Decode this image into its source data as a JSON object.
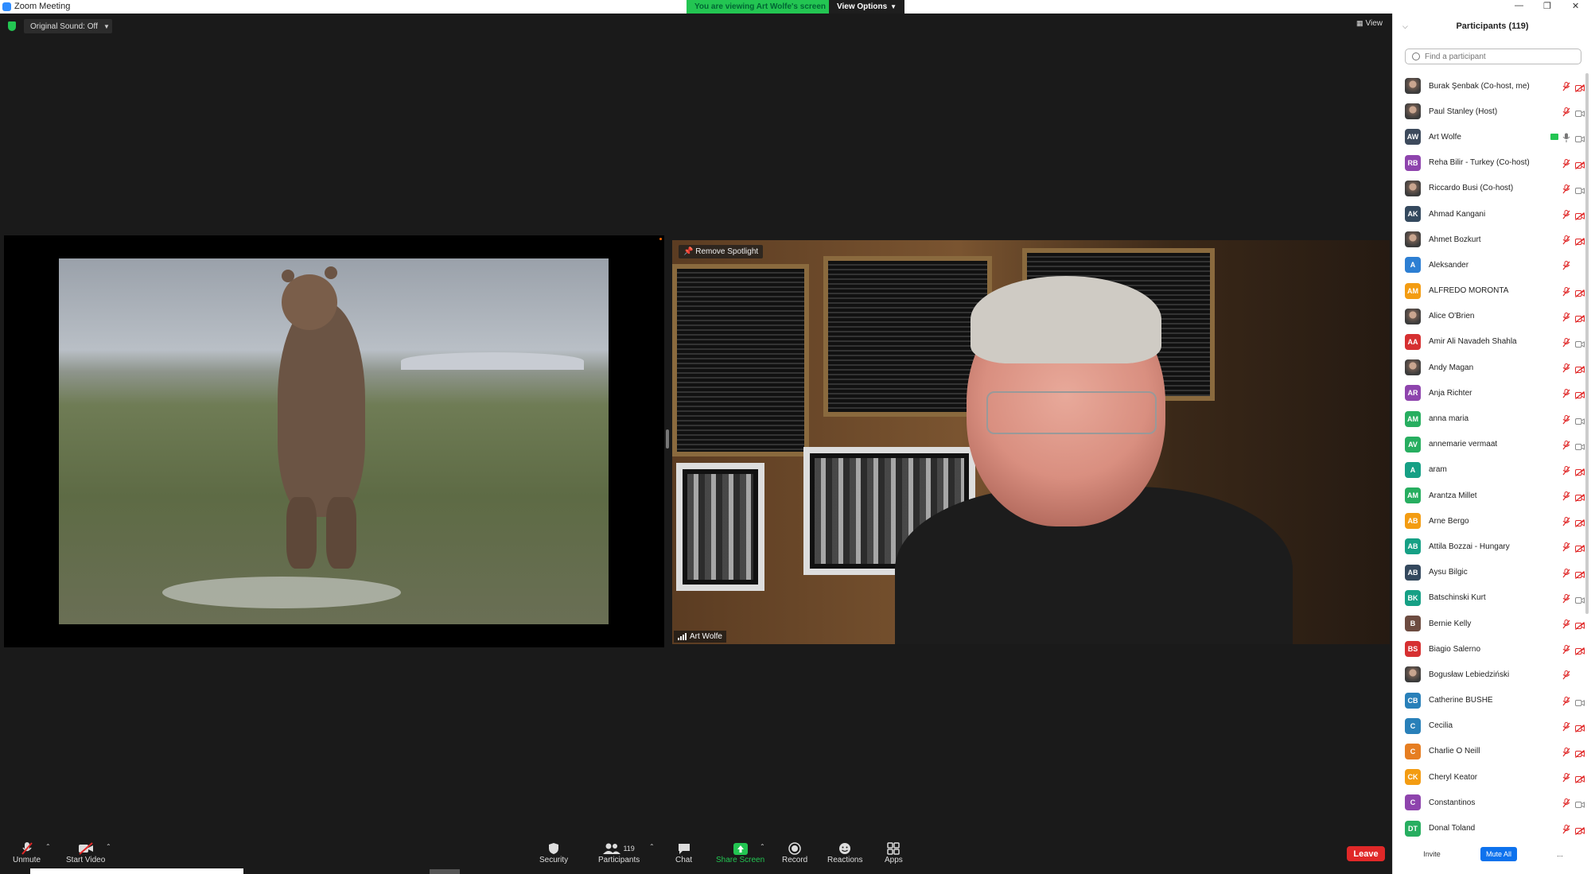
{
  "window": {
    "title": "Zoom Meeting"
  },
  "banner": {
    "viewing_text": "You are viewing Art Wolfe's screen",
    "view_options_label": "View Options"
  },
  "top_left": {
    "original_sound_label": "Original Sound: Off"
  },
  "top_right": {
    "view_label": "View"
  },
  "video": {
    "remove_spotlight_label": "Remove Spotlight",
    "speaker_name": "Art Wolfe"
  },
  "toolbar": {
    "unmute_label": "Unmute",
    "start_video_label": "Start Video",
    "security_label": "Security",
    "participants_label": "Participants",
    "participants_count": "119",
    "chat_label": "Chat",
    "share_screen_label": "Share Screen",
    "record_label": "Record",
    "reactions_label": "Reactions",
    "apps_label": "Apps",
    "leave_label": "Leave"
  },
  "panel": {
    "title": "Participants (119)",
    "search_placeholder": "Find a participant",
    "invite_label": "Invite",
    "mute_all_label": "Mute All",
    "more_label": "...",
    "participants": [
      {
        "name": "Burak Şenbak (Co-host, me)",
        "initials": "",
        "photo": true,
        "color": "#444",
        "mic": "off",
        "video": "off"
      },
      {
        "name": "Paul Stanley (Host)",
        "initials": "",
        "photo": true,
        "color": "#888",
        "mic": "off",
        "video": "on"
      },
      {
        "name": "Art Wolfe",
        "initials": "AW",
        "photo": false,
        "color": "#3d4a5c",
        "mic": "on",
        "video": "on",
        "sharing": true
      },
      {
        "name": "Reha Bilir - Turkey (Co-host)",
        "initials": "RB",
        "photo": false,
        "color": "#8e44ad",
        "mic": "off",
        "video": "off"
      },
      {
        "name": "Riccardo Busi (Co-host)",
        "initials": "",
        "photo": true,
        "color": "#aab",
        "mic": "off",
        "video": "on"
      },
      {
        "name": "Ahmad Kangani",
        "initials": "AK",
        "photo": false,
        "color": "#34495e",
        "mic": "off",
        "video": "off"
      },
      {
        "name": "Ahmet Bozkurt",
        "initials": "",
        "photo": true,
        "color": "#777",
        "mic": "off",
        "video": "off"
      },
      {
        "name": "Aleksander",
        "initials": "A",
        "photo": false,
        "color": "#2d7fd3",
        "mic": "off",
        "video": "none"
      },
      {
        "name": "ALFREDO MORONTA",
        "initials": "AM",
        "photo": false,
        "color": "#f39c12",
        "mic": "off",
        "video": "off"
      },
      {
        "name": "Alice O'Brien",
        "initials": "",
        "photo": true,
        "color": "#a77",
        "mic": "off",
        "video": "off"
      },
      {
        "name": "Amir Ali Navadeh Shahla",
        "initials": "AA",
        "photo": false,
        "color": "#d63031",
        "mic": "off",
        "video": "on"
      },
      {
        "name": "Andy Magan",
        "initials": "",
        "photo": true,
        "color": "#665",
        "mic": "off",
        "video": "off"
      },
      {
        "name": "Anja Richter",
        "initials": "AR",
        "photo": false,
        "color": "#8e44ad",
        "mic": "off",
        "video": "off"
      },
      {
        "name": "anna maria",
        "initials": "AM",
        "photo": false,
        "color": "#27ae60",
        "mic": "off",
        "video": "on"
      },
      {
        "name": "annemarie vermaat",
        "initials": "AV",
        "photo": false,
        "color": "#27ae60",
        "mic": "off",
        "video": "on"
      },
      {
        "name": "aram",
        "initials": "A",
        "photo": false,
        "color": "#16a085",
        "mic": "off",
        "video": "off"
      },
      {
        "name": "Arantza Millet",
        "initials": "AM",
        "photo": false,
        "color": "#27ae60",
        "mic": "off",
        "video": "off"
      },
      {
        "name": "Arne Bergo",
        "initials": "AB",
        "photo": false,
        "color": "#f39c12",
        "mic": "off",
        "video": "off"
      },
      {
        "name": "Attila Bozzai - Hungary",
        "initials": "AB",
        "photo": false,
        "color": "#16a085",
        "mic": "off",
        "video": "off"
      },
      {
        "name": "Aysu Bilgic",
        "initials": "AB",
        "photo": false,
        "color": "#34495e",
        "mic": "off",
        "video": "off"
      },
      {
        "name": "Batschinski Kurt",
        "initials": "BK",
        "photo": false,
        "color": "#16a085",
        "mic": "off",
        "video": "on"
      },
      {
        "name": "Bernie Kelly",
        "initials": "B",
        "photo": false,
        "color": "#6d4c41",
        "mic": "off",
        "video": "off"
      },
      {
        "name": "Biagio Salerno",
        "initials": "BS",
        "photo": false,
        "color": "#d63031",
        "mic": "off",
        "video": "off"
      },
      {
        "name": "Bogusław Lebiedziński",
        "initials": "",
        "photo": true,
        "color": "#776",
        "mic": "off",
        "video": "none"
      },
      {
        "name": "Catherine BUSHE",
        "initials": "CB",
        "photo": false,
        "color": "#2980b9",
        "mic": "off",
        "video": "on"
      },
      {
        "name": "Cecilia",
        "initials": "C",
        "photo": false,
        "color": "#2980b9",
        "mic": "off",
        "video": "off"
      },
      {
        "name": "Charlie O Neill",
        "initials": "C",
        "photo": false,
        "color": "#e67e22",
        "mic": "off",
        "video": "off"
      },
      {
        "name": "Cheryl Keator",
        "initials": "CK",
        "photo": false,
        "color": "#f39c12",
        "mic": "off",
        "video": "off"
      },
      {
        "name": "Constantinos",
        "initials": "C",
        "photo": false,
        "color": "#8e44ad",
        "mic": "off",
        "video": "on"
      },
      {
        "name": "Donal Toland",
        "initials": "DT",
        "photo": false,
        "color": "#27ae60",
        "mic": "off",
        "video": "off"
      }
    ]
  },
  "colors": {
    "accent": "#2d8cff",
    "share_green": "#23c552",
    "leave_red": "#e02828",
    "muted_red": "#e02828"
  }
}
